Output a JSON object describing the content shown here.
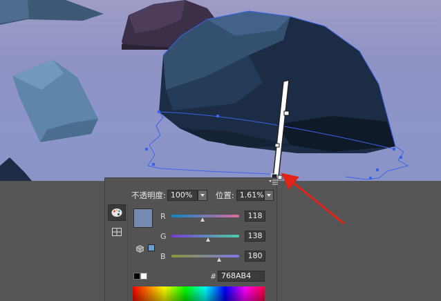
{
  "canvas": {
    "background": "#9199c9",
    "objects": [
      "rock-large",
      "rock-medium-top",
      "rock-small-left",
      "rock-top-left",
      "rock-bottom-left"
    ]
  },
  "panel": {
    "opacity_label": "不透明度:",
    "opacity_value": "100%",
    "position_label": "位置:",
    "position_value": "1.61%",
    "tools": [
      "palette-icon",
      "swatch-grid-icon"
    ],
    "current_color": "#768AB4",
    "sliders": [
      {
        "label": "R",
        "value": "118",
        "level": 0.463
      },
      {
        "label": "G",
        "value": "138",
        "level": 0.541
      },
      {
        "label": "B",
        "value": "180",
        "level": 0.706
      }
    ],
    "hash_label": "#",
    "hex_value": "768AB4"
  },
  "annotation": {
    "arrow_color": "#e2231a"
  }
}
